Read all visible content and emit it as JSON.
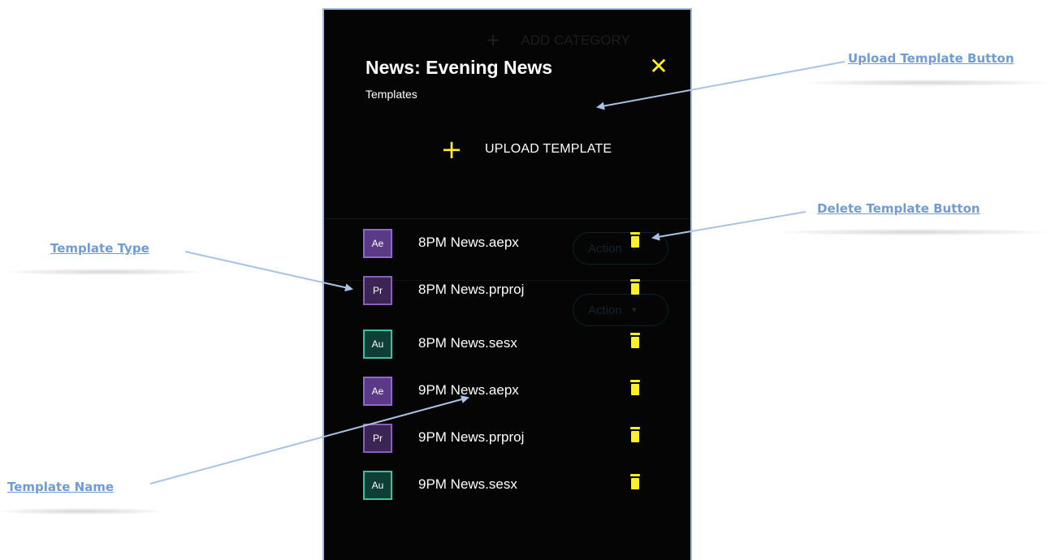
{
  "panel": {
    "title": "News: Evening News",
    "subtitle": "Templates",
    "close_icon": "close-icon",
    "background_label": "ADD CATEGORY",
    "background_action_label": "Action",
    "upload": {
      "icon": "plus-icon",
      "label": "UPLOAD TEMPLATE"
    },
    "templates": [
      {
        "type": "Ae",
        "name": "8PM News.aepx"
      },
      {
        "type": "Pr",
        "name": "8PM News.prproj"
      },
      {
        "type": "Au",
        "name": "8PM News.sesx"
      },
      {
        "type": "Ae",
        "name": "9PM News.aepx"
      },
      {
        "type": "Pr",
        "name": "9PM News.prproj"
      },
      {
        "type": "Au",
        "name": "9PM News.sesx"
      }
    ],
    "delete_icon": "trash-icon"
  },
  "annotations": {
    "upload_button": "Upload Template Button",
    "delete_button": "Delete Template Button",
    "template_type": "Template Type",
    "template_name": "Template Name"
  },
  "colors": {
    "panel_bg": "#050505",
    "accent_yellow": "#ffef2a",
    "annotation_blue": "#6f9bd8",
    "ae_badge": "#5a3a87",
    "pr_badge": "#3b2554",
    "au_badge": "#0e3f36"
  }
}
